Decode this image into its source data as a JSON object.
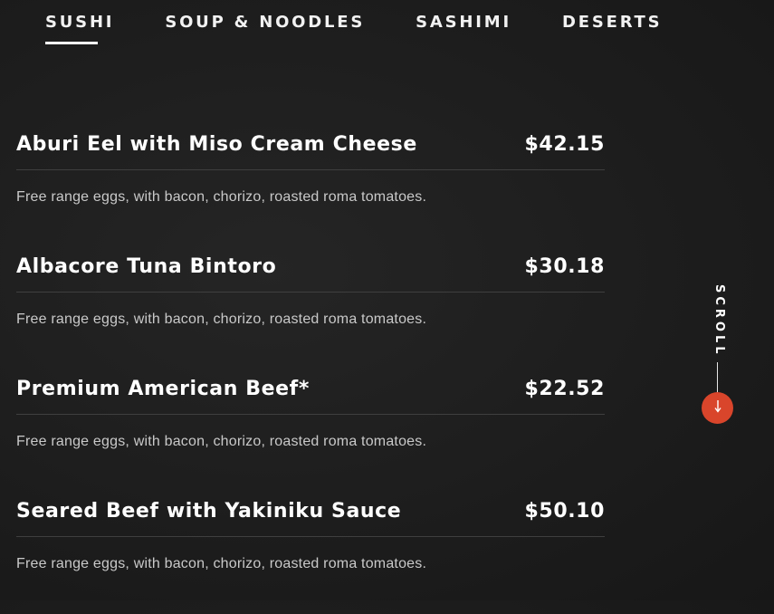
{
  "tabs": [
    {
      "label": "SUSHI",
      "active": true
    },
    {
      "label": "SOUP & NOODLES",
      "active": false
    },
    {
      "label": "SASHIMI",
      "active": false
    },
    {
      "label": "DESERTS",
      "active": false
    }
  ],
  "menu": {
    "items": [
      {
        "name": "Aburi Eel with Miso Cream Cheese",
        "price": "$42.15",
        "description": "Free range eggs, with bacon, chorizo, roasted roma tomatoes."
      },
      {
        "name": "Albacore Tuna Bintoro",
        "price": "$30.18",
        "description": "Free range eggs, with bacon, chorizo, roasted roma tomatoes."
      },
      {
        "name": "Premium American Beef*",
        "price": "$22.52",
        "description": "Free range eggs, with bacon, chorizo, roasted roma tomatoes."
      },
      {
        "name": "Seared Beef with Yakiniku Sauce",
        "price": "$50.10",
        "description": "Free range eggs, with bacon, chorizo, roasted roma tomatoes."
      }
    ]
  },
  "scroll": {
    "label": "SCROLL",
    "icon": "arrow-down-icon",
    "accent_color": "#d9452b"
  }
}
